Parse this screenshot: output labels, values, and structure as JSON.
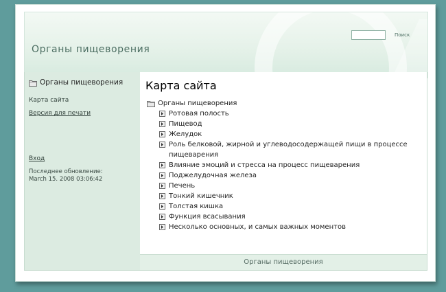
{
  "header": {
    "site_title": "Органы пищеворения",
    "search_placeholder": "",
    "search_label": "Поиск"
  },
  "sidebar": {
    "section_title": "Органы пищеворения",
    "sitemap_label": "Карта сайта",
    "print_version_label": "Версия для печати",
    "login_label": "Вход",
    "last_updated_label": "Последнее обновление:",
    "last_updated_value": "March 15. 2008 03:06:42"
  },
  "main": {
    "title": "Карта сайта",
    "tree_root": "Органы пищеворения",
    "tree_items": [
      "Ротовая полость",
      "Пищевод",
      "Желудок",
      "Роль белковой, жирной и углеводосодержащей пищи в процессе пищеварения",
      "Влияние эмоций и стресса на процесс пищеварения",
      "Поджелудочная железа",
      "Печень",
      "Тонкий кишечник",
      "Толстая кишка",
      "Функция всасывания",
      "Несколько основных, и самых важных моментов"
    ]
  },
  "footer": {
    "text": "Органы пищеворения"
  },
  "icons": {
    "folder": "folder-icon",
    "expand": "plus-box-icon"
  },
  "colors": {
    "background": "#5f9c9c",
    "sidebar": "#dcebe1",
    "title_text": "#4c6e62"
  }
}
